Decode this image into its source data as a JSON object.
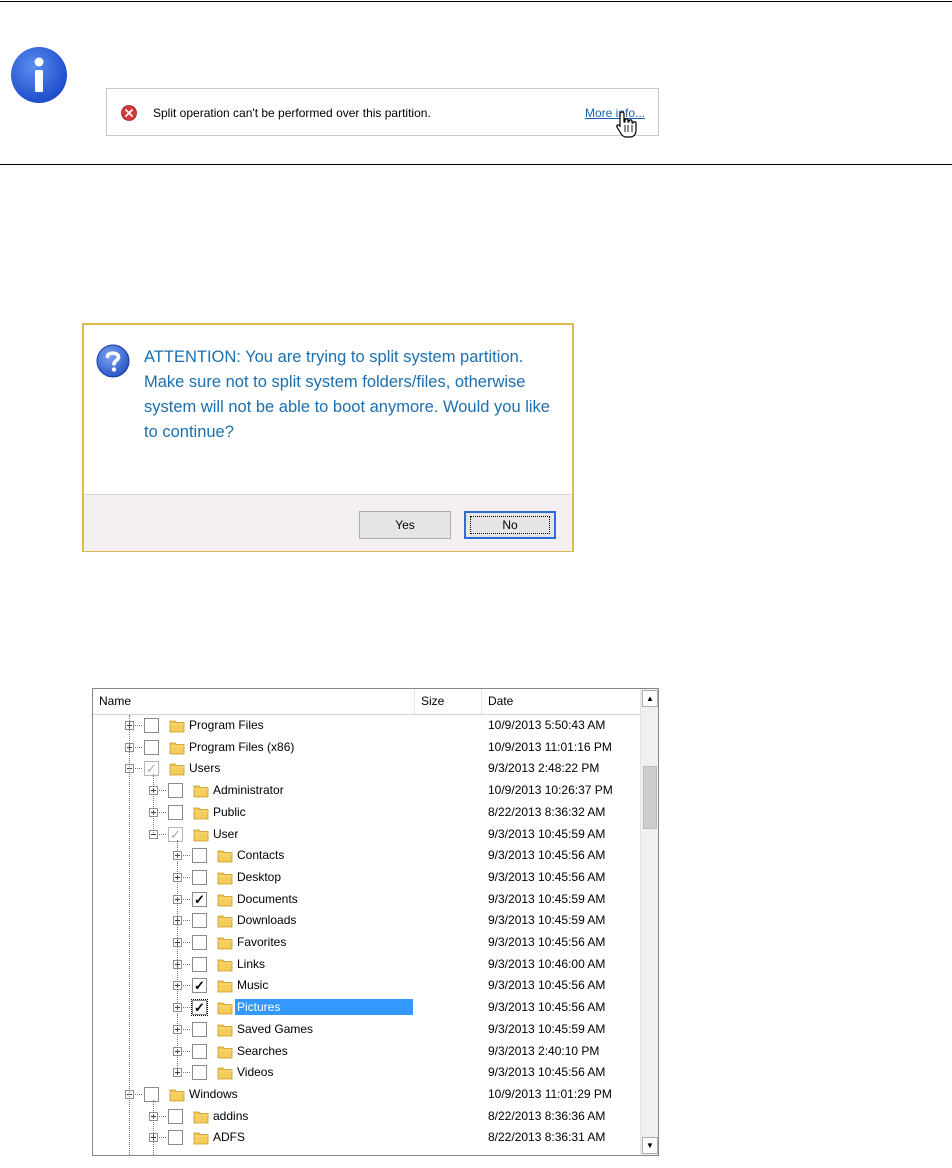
{
  "info_note": {
    "message": "Split operation can't be performed over this partition.",
    "link_label": "More info..."
  },
  "dialog": {
    "message": "ATTENTION: You are trying to split system partition. Make sure not to split system folders/files, otherwise system will not be able to boot anymore. Would you like to continue?",
    "yes_label": "Yes",
    "no_label": "No"
  },
  "tree": {
    "columns": {
      "name": "Name",
      "size": "Size",
      "date": "Date"
    },
    "rows": [
      {
        "level": 0,
        "expand": "plus",
        "check": "off",
        "name": "Program Files",
        "date": "10/9/2013 5:50:43 AM"
      },
      {
        "level": 0,
        "expand": "plus",
        "check": "off",
        "name": "Program Files (x86)",
        "date": "10/9/2013 11:01:16 PM"
      },
      {
        "level": 0,
        "expand": "minus",
        "check": "partial",
        "name": "Users",
        "date": "9/3/2013 2:48:22 PM"
      },
      {
        "level": 1,
        "expand": "plus",
        "check": "off",
        "name": "Administrator",
        "date": "10/9/2013 10:26:37 PM"
      },
      {
        "level": 1,
        "expand": "plus",
        "check": "off",
        "name": "Public",
        "date": "8/22/2013 8:36:32 AM"
      },
      {
        "level": 1,
        "expand": "minus",
        "check": "partial",
        "name": "User",
        "date": "9/3/2013 10:45:59 AM"
      },
      {
        "level": 2,
        "expand": "plus",
        "check": "off",
        "name": "Contacts",
        "date": "9/3/2013 10:45:56 AM"
      },
      {
        "level": 2,
        "expand": "plus",
        "check": "off",
        "name": "Desktop",
        "date": "9/3/2013 10:45:56 AM"
      },
      {
        "level": 2,
        "expand": "plus",
        "check": "on",
        "name": "Documents",
        "date": "9/3/2013 10:45:59 AM"
      },
      {
        "level": 2,
        "expand": "plus",
        "check": "off",
        "name": "Downloads",
        "date": "9/3/2013 10:45:59 AM"
      },
      {
        "level": 2,
        "expand": "plus",
        "check": "off",
        "name": "Favorites",
        "date": "9/3/2013 10:45:56 AM"
      },
      {
        "level": 2,
        "expand": "plus",
        "check": "off",
        "name": "Links",
        "date": "9/3/2013 10:46:00 AM"
      },
      {
        "level": 2,
        "expand": "plus",
        "check": "on",
        "name": "Music",
        "date": "9/3/2013 10:45:56 AM"
      },
      {
        "level": 2,
        "expand": "plus",
        "check": "on",
        "name": "Pictures",
        "date": "9/3/2013 10:45:56 AM",
        "selected": true
      },
      {
        "level": 2,
        "expand": "plus",
        "check": "off",
        "name": "Saved Games",
        "date": "9/3/2013 10:45:59 AM"
      },
      {
        "level": 2,
        "expand": "plus",
        "check": "off",
        "name": "Searches",
        "date": "9/3/2013 2:40:10 PM"
      },
      {
        "level": 2,
        "expand": "plus",
        "check": "off",
        "name": "Videos",
        "date": "9/3/2013 10:45:56 AM"
      },
      {
        "level": 0,
        "expand": "minus",
        "check": "off",
        "name": "Windows",
        "date": "10/9/2013 11:01:29 PM"
      },
      {
        "level": 1,
        "expand": "plus",
        "check": "off",
        "name": "addins",
        "date": "8/22/2013 8:36:36 AM"
      },
      {
        "level": 1,
        "expand": "plus",
        "check": "off",
        "name": "ADFS",
        "date": "8/22/2013 8:36:31 AM"
      }
    ]
  },
  "icons": {
    "info": "info-icon",
    "error": "error-icon",
    "question": "question-icon",
    "folder": "folder-icon",
    "cursor": "hand-cursor-icon"
  },
  "colors": {
    "info_blue": "#2563d8",
    "dialog_text": "#1b6fb0",
    "dialog_border": "#e2b84a",
    "selection": "#3399ff",
    "folder": "#f0c24a"
  }
}
